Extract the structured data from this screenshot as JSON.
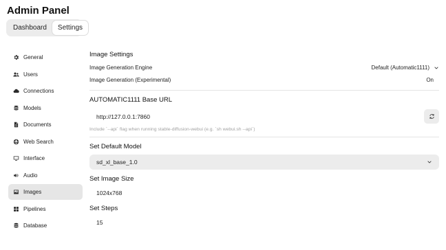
{
  "header": {
    "title": "Admin Panel"
  },
  "tabs": [
    {
      "label": "Dashboard"
    },
    {
      "label": "Settings",
      "active": true
    }
  ],
  "sidebar": {
    "items": [
      {
        "label": "General",
        "icon": "gear-icon"
      },
      {
        "label": "Users",
        "icon": "users-icon"
      },
      {
        "label": "Connections",
        "icon": "cloud-icon"
      },
      {
        "label": "Models",
        "icon": "database-icon"
      },
      {
        "label": "Documents",
        "icon": "document-icon"
      },
      {
        "label": "Web Search",
        "icon": "globe-icon"
      },
      {
        "label": "Interface",
        "icon": "monitor-icon"
      },
      {
        "label": "Audio",
        "icon": "speaker-icon"
      },
      {
        "label": "Images",
        "icon": "image-icon",
        "active": true
      },
      {
        "label": "Pipelines",
        "icon": "pipelines-icon"
      },
      {
        "label": "Database",
        "icon": "database-icon"
      }
    ]
  },
  "image_settings": {
    "heading": "Image Settings",
    "engine_label": "Image Generation Engine",
    "engine_value": "Default (Automatic1111)",
    "experimental_label": "Image Generation (Experimental)",
    "experimental_value": "On"
  },
  "base_url": {
    "heading": "AUTOMATIC1111 Base URL",
    "value": "http://127.0.0.1:7860",
    "hint": "Include `--api` flag when running stable-diffusion-webui (e.g. `sh webui.sh --api`)"
  },
  "default_model": {
    "heading": "Set Default Model",
    "value": "sd_xl_base_1.0"
  },
  "image_size": {
    "heading": "Set Image Size",
    "value": "1024x768"
  },
  "steps": {
    "heading": "Set Steps",
    "value": "15"
  }
}
